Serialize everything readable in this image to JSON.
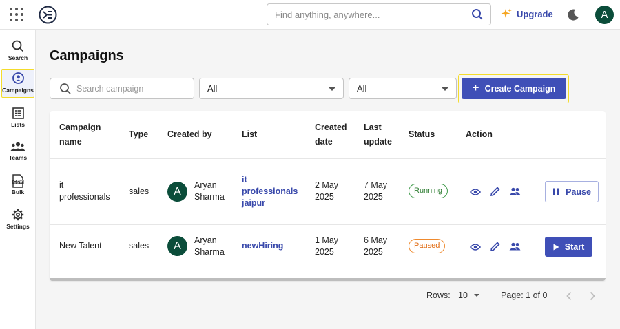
{
  "header": {
    "search_placeholder": "Find anything, anywhere...",
    "upgrade_label": "Upgrade",
    "avatar_initial": "A"
  },
  "sidebar": {
    "items": [
      {
        "label": "Search",
        "icon": "search-icon"
      },
      {
        "label": "Campaigns",
        "icon": "campaigns-icon",
        "active": true
      },
      {
        "label": "Lists",
        "icon": "list-icon"
      },
      {
        "label": "Teams",
        "icon": "teams-icon"
      },
      {
        "label": "Bulk",
        "icon": "csv-icon"
      },
      {
        "label": "Settings",
        "icon": "gear-icon"
      }
    ]
  },
  "page": {
    "title": "Campaigns",
    "search_placeholder": "Search campaign",
    "filter_type": "All",
    "filter_status": "All",
    "create_label": "Create Campaign"
  },
  "table": {
    "headers": {
      "campaign_name": [
        "Campaign",
        "name"
      ],
      "type": "Type",
      "created_by": "Created by",
      "list": "List",
      "created_date": [
        "Created",
        "date"
      ],
      "last_update": [
        "Last",
        "update"
      ],
      "status": "Status",
      "action": "Action"
    },
    "rows": [
      {
        "name": [
          "it",
          "professionals"
        ],
        "type": "sales",
        "creator_initial": "A",
        "creator": [
          "Aryan",
          "Sharma"
        ],
        "list": [
          "it",
          "professionals",
          "jaipur"
        ],
        "created": [
          "2 May",
          "2025"
        ],
        "updated": [
          "7 May",
          "2025"
        ],
        "status": "Running",
        "action_label": "Pause"
      },
      {
        "name": [
          "New Talent"
        ],
        "type": "sales",
        "creator_initial": "A",
        "creator": [
          "Aryan",
          "Sharma"
        ],
        "list": [
          "newHiring"
        ],
        "created": [
          "1 May",
          "2025"
        ],
        "updated": [
          "6 May",
          "2025"
        ],
        "status": "Paused",
        "action_label": "Start"
      }
    ]
  },
  "pagination": {
    "rows_label": "Rows:",
    "rows_value": "10",
    "page_label": "Page: 1 of 0"
  },
  "colors": {
    "primary": "#3f4fb7",
    "avatar": "#0b4d3a",
    "running": "#2e7d32",
    "paused": "#e06c14",
    "highlight": "#f4dc2b"
  }
}
